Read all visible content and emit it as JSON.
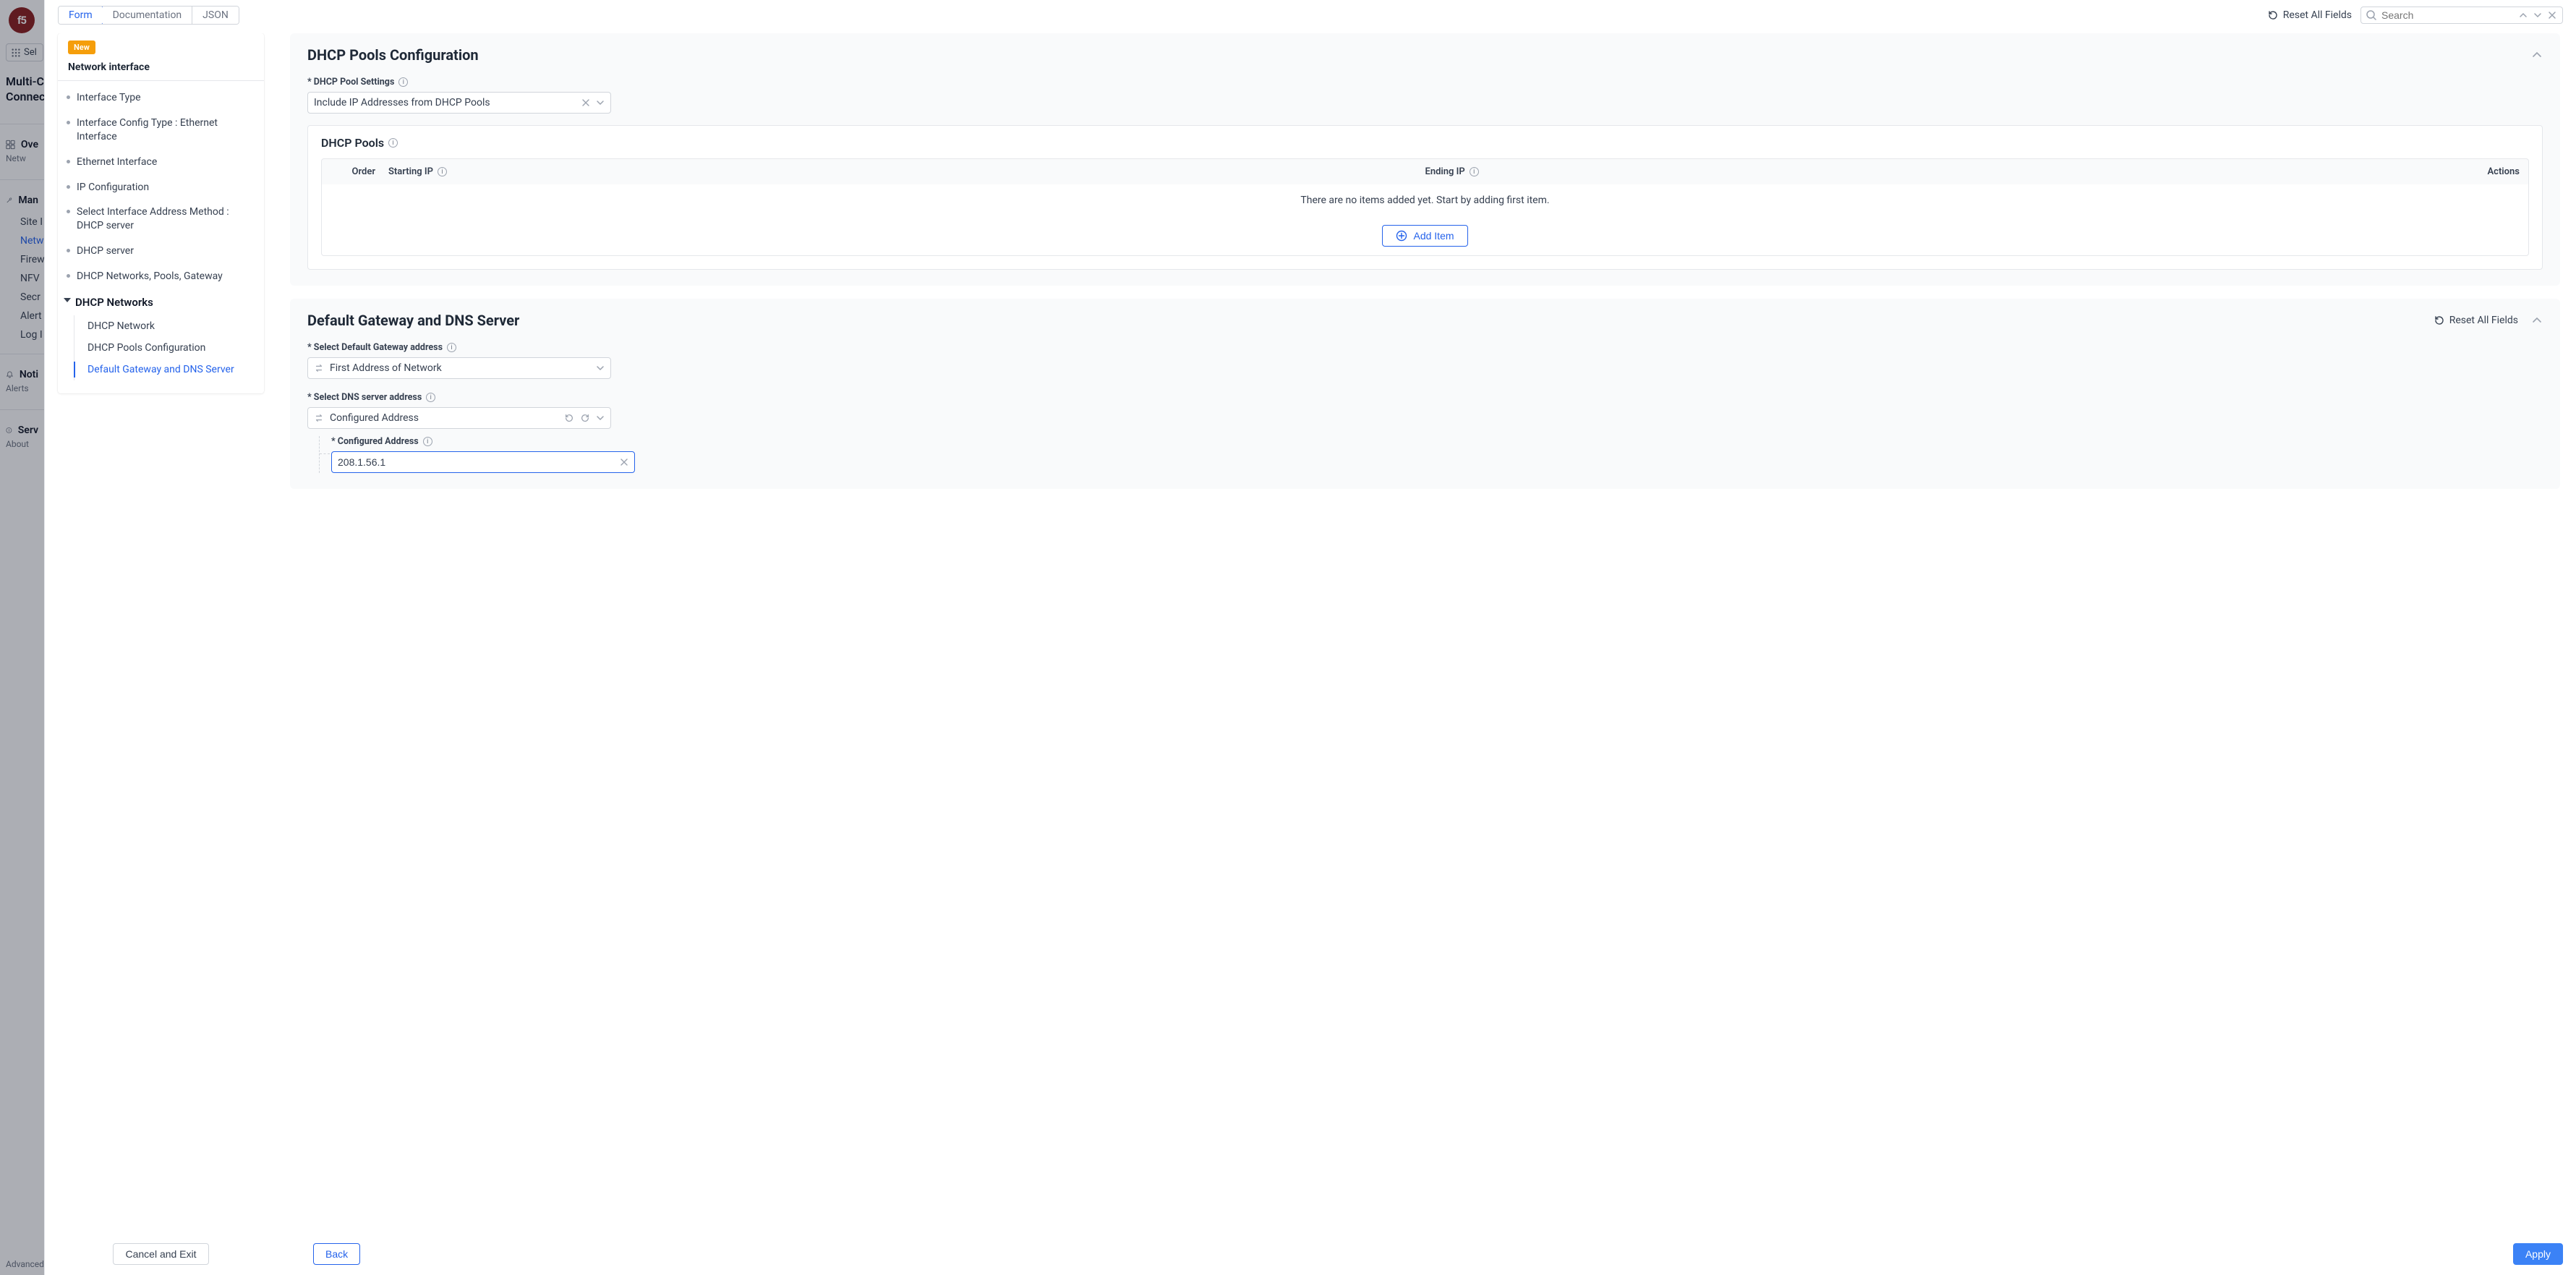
{
  "bg_nav": {
    "logo": "f5",
    "select": "Sel",
    "app_title1": "Multi-C",
    "app_title2": "Connec",
    "overview": "Ove",
    "overview_sub": "Netw",
    "manage": "Man",
    "items": [
      "Site I",
      "Netw",
      "Firew",
      "NFV",
      "Secr",
      "Alert",
      "Log I"
    ],
    "notif": "Noti",
    "notif_sub": "Alerts",
    "serv": "Serv",
    "serv_sub": "About",
    "bottom": "Advanced"
  },
  "toolbar": {
    "tabs": {
      "form": "Form",
      "doc": "Documentation",
      "json": "JSON"
    },
    "reset_all": "Reset All Fields",
    "search_placeholder": "Search"
  },
  "side": {
    "badge": "New",
    "title": "Network interface",
    "items": {
      "t1": "Interface Type",
      "t2": "Interface Config Type : Ethernet Interface",
      "t3": "Ethernet Interface",
      "t4": "IP Configuration",
      "t5": "Select Interface Address Method : DHCP server",
      "t6": "DHCP server",
      "t7": "DHCP Networks, Pools, Gateway",
      "group": "DHCP Networks",
      "s1": "DHCP Network",
      "s2": "DHCP Pools Configuration",
      "s3": "Default Gateway and DNS Server"
    }
  },
  "cards": {
    "pools": {
      "title": "DHCP Pools Configuration",
      "settings_label": "* DHCP Pool Settings",
      "settings_value": "Include IP Addresses from DHCP Pools",
      "box_title": "DHCP Pools",
      "cols": {
        "order": "Order",
        "start": "Starting IP",
        "end": "Ending IP",
        "actions": "Actions"
      },
      "empty": "There are no items added yet. Start by adding first item.",
      "add": "Add Item"
    },
    "gw": {
      "title": "Default Gateway and DNS Server",
      "reset": "Reset All Fields",
      "gw_label": "* Select Default Gateway address",
      "gw_value": "First Address of Network",
      "dns_label": "* Select DNS server address",
      "dns_value": "Configured Address",
      "addr_label": "* Configured Address",
      "addr_value": "208.1.56.1"
    }
  },
  "footer": {
    "cancel": "Cancel and Exit",
    "back": "Back",
    "apply": "Apply"
  }
}
